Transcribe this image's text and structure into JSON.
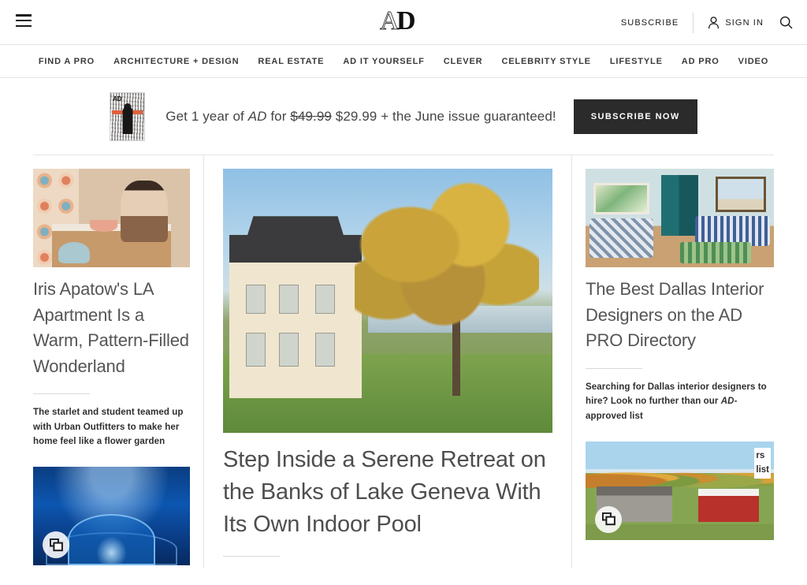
{
  "site": {
    "brand": "AD",
    "brand_a": "A",
    "brand_d": "D"
  },
  "header": {
    "menu_icon": "hamburger-menu-icon",
    "subscribe_label": "SUBSCRIBE",
    "signin_label": "SIGN IN",
    "account_icon": "person-icon",
    "search_icon": "search-icon"
  },
  "nav": {
    "items": [
      {
        "label": "FIND A PRO"
      },
      {
        "label": "ARCHITECTURE + DESIGN"
      },
      {
        "label": "REAL ESTATE"
      },
      {
        "label": "AD IT YOURSELF"
      },
      {
        "label": "CLEVER"
      },
      {
        "label": "CELEBRITY STYLE"
      },
      {
        "label": "LIFESTYLE"
      },
      {
        "label": "AD PRO"
      },
      {
        "label": "VIDEO"
      }
    ]
  },
  "promo": {
    "cover_alt": "magazine-cover-thumbnail",
    "cover_title": "AD",
    "text_before": "Get 1 year of ",
    "text_brand": "AD",
    "text_for": " for ",
    "old_price": "$49.99",
    "new_price": "$29.99",
    "text_after": " + the June issue guaranteed!",
    "cta_label": "SUBSCRIBE NOW"
  },
  "main": {
    "left_column": [
      {
        "id": "iris-apatow",
        "image_alt": "woman-in-patterned-kitchen",
        "headline": "Iris Apatow's LA Apartment Is a Warm, Pattern-Filled Wonderland",
        "dek_part1": "The starlet and student teamed up with Urban Outfitters to make her home feel like a flower garden",
        "has_gallery_badge": false
      },
      {
        "id": "underwater-room",
        "image_alt": "underwater-glass-dome-lounge",
        "has_gallery_badge": true,
        "gallery_icon": "gallery-stack-icon"
      }
    ],
    "center_column": {
      "id": "lake-geneva",
      "image_alt": "lakeside-manor-house-with-autumn-tree",
      "gallery_icon": "gallery-stack-icon",
      "headline": "Step Inside a Serene Retreat on the Banks of Lake Geneva With Its Own Indoor Pool"
    },
    "right_column": [
      {
        "id": "dallas-designers",
        "image_alt": "blue-and-green-living-room",
        "headline": "The Best Dallas Interior Designers on the AD PRO Directory",
        "dek_part1": "Searching for Dallas interior designers to hire? Look no further than our ",
        "dek_italic": "AD-",
        "dek_part2": "approved list"
      },
      {
        "id": "country-estate",
        "image_alt": "autumn-country-estate-with-red-barn",
        "has_gallery_badge": true,
        "gallery_icon": "gallery-stack-icon",
        "overflow_line1": "rs",
        "overflow_line2": "list"
      }
    ]
  },
  "colors": {
    "text_primary": "#1a1a1a",
    "text_headline": "#555555",
    "rule": "#e4e4e4",
    "cta_background": "#2b2b2b",
    "cta_text": "#ffffff",
    "promo_accent": "#e2603c"
  }
}
